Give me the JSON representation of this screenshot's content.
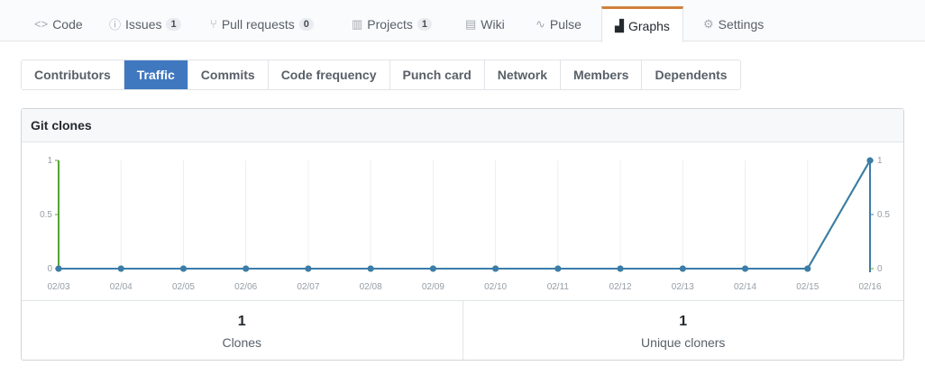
{
  "repo_tabs": [
    {
      "label": "Code",
      "icon": "code-icon",
      "glyph": "<>"
    },
    {
      "label": "Issues",
      "icon": "issue-icon",
      "glyph": "ⓘ",
      "count": "1"
    },
    {
      "label": "Pull requests",
      "icon": "pull-request-icon",
      "glyph": "⑂",
      "count": "0"
    },
    {
      "label": "Projects",
      "icon": "project-icon",
      "glyph": "▥",
      "count": "1"
    },
    {
      "label": "Wiki",
      "icon": "book-icon",
      "glyph": "▤"
    },
    {
      "label": "Pulse",
      "icon": "pulse-icon",
      "glyph": "∿"
    },
    {
      "label": "Graphs",
      "icon": "graph-icon",
      "glyph": "▟"
    },
    {
      "label": "Settings",
      "icon": "gear-icon",
      "glyph": "⚙"
    }
  ],
  "sub_tabs": [
    "Contributors",
    "Traffic",
    "Commits",
    "Code frequency",
    "Punch card",
    "Network",
    "Members",
    "Dependents"
  ],
  "panel": {
    "title": "Git clones"
  },
  "stats": [
    {
      "value": "1",
      "label": "Clones"
    },
    {
      "value": "1",
      "label": "Unique cloners"
    }
  ],
  "chart_data": {
    "type": "line",
    "title": "Git clones",
    "x": [
      "02/03",
      "02/04",
      "02/05",
      "02/06",
      "02/07",
      "02/08",
      "02/09",
      "02/10",
      "02/11",
      "02/12",
      "02/13",
      "02/14",
      "02/15",
      "02/16"
    ],
    "series": [
      {
        "name": "Clones",
        "axis": "left",
        "color": "#55a532",
        "values": [
          0,
          0,
          0,
          0,
          0,
          0,
          0,
          0,
          0,
          0,
          0,
          0,
          0,
          1
        ]
      },
      {
        "name": "Unique cloners",
        "axis": "right",
        "color": "#3b7cab",
        "values": [
          0,
          0,
          0,
          0,
          0,
          0,
          0,
          0,
          0,
          0,
          0,
          0,
          0,
          1
        ]
      }
    ],
    "y_ticks": [
      "0",
      "0.5",
      "1"
    ],
    "ylim": [
      0,
      1
    ],
    "grid": "vertical"
  }
}
